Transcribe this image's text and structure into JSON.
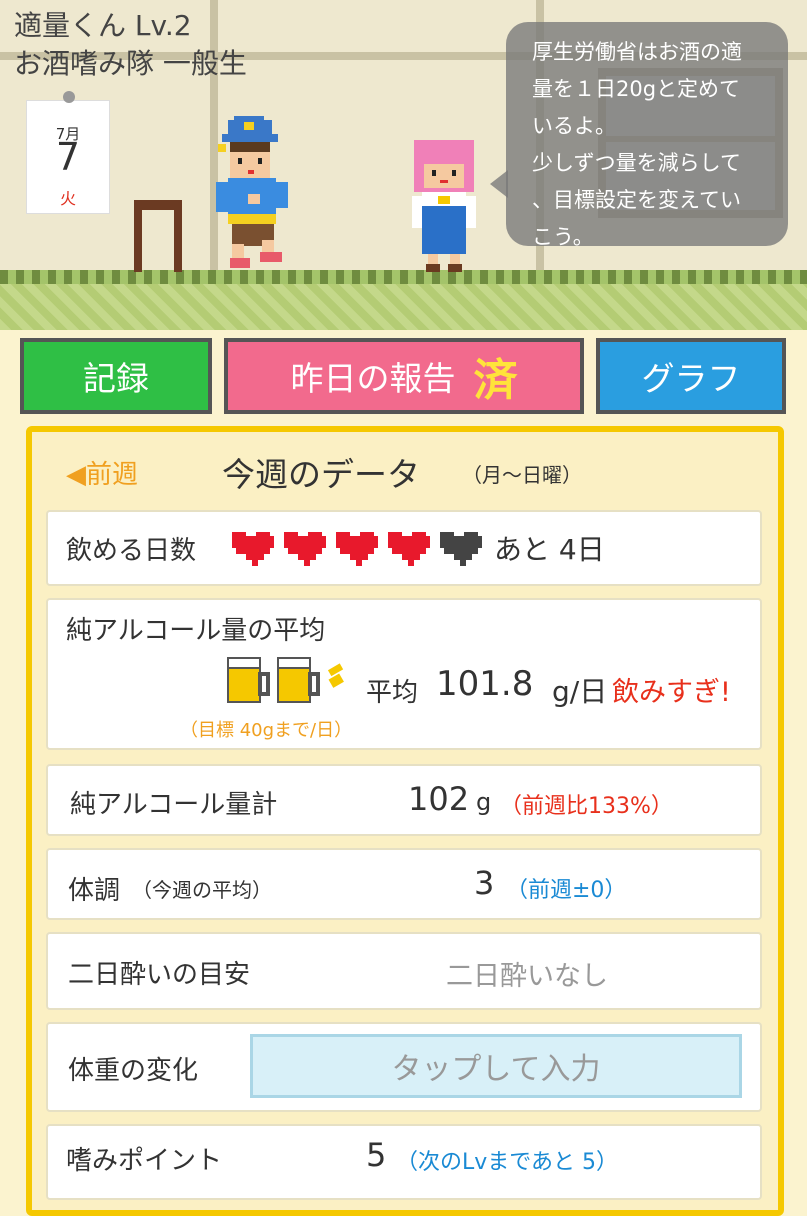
{
  "header": {
    "app_title": "適量くん Lv.2",
    "rank": "お酒嗜み隊 一般生"
  },
  "calendar": {
    "month": "7月",
    "day": "7",
    "weekday": "火"
  },
  "speech_bubble": {
    "lines": [
      "厚生労働省はお酒の適",
      "量を１日20gと定めて",
      "いるよ。",
      "少しずつ量を減らして",
      "、目標設定を変えてい",
      "こう。"
    ]
  },
  "buttons": {
    "record": "記録",
    "report": "昨日の報告",
    "report_status": "済",
    "graph": "グラフ"
  },
  "week": {
    "prev": "◀前週",
    "title": "今週のデータ",
    "range": "（月～日曜）"
  },
  "drink_days": {
    "label": "飲める日数",
    "hearts_filled": 4,
    "hearts_total": 5,
    "remaining": "あと 4日"
  },
  "alcohol_avg": {
    "label": "純アルコール量の平均",
    "avg_prefix": "平均",
    "value": "101.8",
    "unit": "g/日",
    "warning": "飲みすぎ!",
    "target": "（目標 40gまで/日）"
  },
  "alcohol_total": {
    "label": "純アルコール量計",
    "value": "102",
    "unit": "g",
    "compare": "（前週比133%）"
  },
  "condition": {
    "label": "体調",
    "label_note": "（今週の平均）",
    "value": "3",
    "compare": "（前週±0）"
  },
  "hangover": {
    "label": "二日酔いの目安",
    "value": "二日酔いなし"
  },
  "weight": {
    "label": "体重の変化",
    "input_placeholder": "タップして入力"
  },
  "points": {
    "label": "嗜みポイント",
    "value": "5",
    "note": "（次のLvまであと 5）"
  },
  "colors": {
    "record_green": "#2fbf45",
    "report_pink": "#f26a8d",
    "graph_blue": "#2a9ee0",
    "panel_yellow": "#f5c800",
    "heart_red": "#e8192c",
    "warning_red": "#e8301c",
    "compare_blue": "#1a8ad4"
  }
}
